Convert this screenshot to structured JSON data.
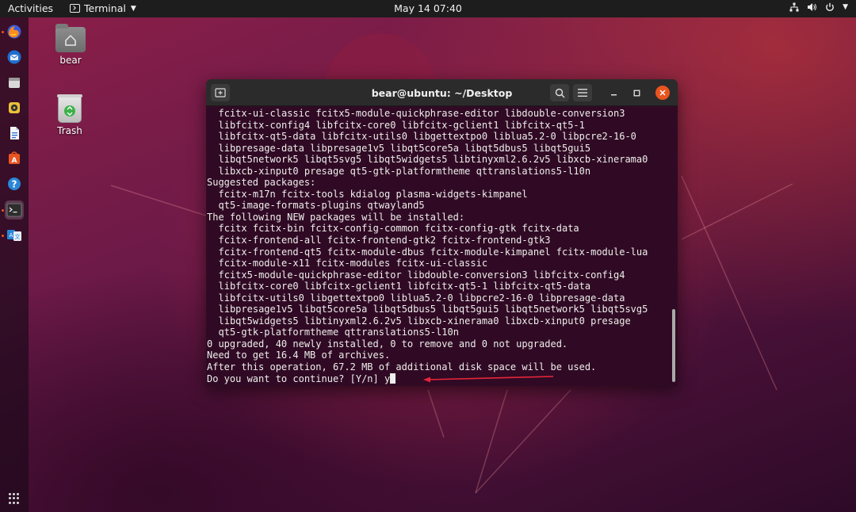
{
  "topbar": {
    "activities": "Activities",
    "app_name": "Terminal",
    "clock": "May 14  07:40"
  },
  "desktop": {
    "home_label": "bear",
    "trash_label": "Trash"
  },
  "dock": {
    "items": [
      "firefox-icon",
      "thunderbird-icon",
      "files-icon",
      "rhythmbox-icon",
      "libreoffice-writer-icon",
      "software-center-icon",
      "help-icon",
      "terminal-icon",
      "language-support-icon"
    ],
    "active": "terminal-icon"
  },
  "terminal": {
    "title": "bear@ubuntu: ~/Desktop",
    "lines": [
      {
        "text": "fcitx-ui-classic fcitx5-module-quickphrase-editor libdouble-conversion3",
        "indent": true
      },
      {
        "text": "libfcitx-config4 libfcitx-core0 libfcitx-gclient1 libfcitx-qt5-1",
        "indent": true
      },
      {
        "text": "libfcitx-qt5-data libfcitx-utils0 libgettextpo0 liblua5.2-0 libpcre2-16-0",
        "indent": true
      },
      {
        "text": "libpresage-data libpresage1v5 libqt5core5a libqt5dbus5 libqt5gui5",
        "indent": true
      },
      {
        "text": "libqt5network5 libqt5svg5 libqt5widgets5 libtinyxml2.6.2v5 libxcb-xinerama0",
        "indent": true
      },
      {
        "text": "libxcb-xinput0 presage qt5-gtk-platformtheme qttranslations5-l10n",
        "indent": true
      },
      {
        "text": "Suggested packages:",
        "indent": false
      },
      {
        "text": "fcitx-m17n fcitx-tools kdialog plasma-widgets-kimpanel",
        "indent": true
      },
      {
        "text": "qt5-image-formats-plugins qtwayland5",
        "indent": true
      },
      {
        "text": "The following NEW packages will be installed:",
        "indent": false
      },
      {
        "text": "fcitx fcitx-bin fcitx-config-common fcitx-config-gtk fcitx-data",
        "indent": true
      },
      {
        "text": "fcitx-frontend-all fcitx-frontend-gtk2 fcitx-frontend-gtk3",
        "indent": true
      },
      {
        "text": "fcitx-frontend-qt5 fcitx-module-dbus fcitx-module-kimpanel fcitx-module-lua",
        "indent": true
      },
      {
        "text": "fcitx-module-x11 fcitx-modules fcitx-ui-classic",
        "indent": true
      },
      {
        "text": "fcitx5-module-quickphrase-editor libdouble-conversion3 libfcitx-config4",
        "indent": true
      },
      {
        "text": "libfcitx-core0 libfcitx-gclient1 libfcitx-qt5-1 libfcitx-qt5-data",
        "indent": true
      },
      {
        "text": "libfcitx-utils0 libgettextpo0 liblua5.2-0 libpcre2-16-0 libpresage-data",
        "indent": true
      },
      {
        "text": "libpresage1v5 libqt5core5a libqt5dbus5 libqt5gui5 libqt5network5 libqt5svg5",
        "indent": true
      },
      {
        "text": "libqt5widgets5 libtinyxml2.6.2v5 libxcb-xinerama0 libxcb-xinput0 presage",
        "indent": true
      },
      {
        "text": "qt5-gtk-platformtheme qttranslations5-l10n",
        "indent": true
      },
      {
        "text": "0 upgraded, 40 newly installed, 0 to remove and 0 not upgraded.",
        "indent": false
      },
      {
        "text": "Need to get 16.4 MB of archives.",
        "indent": false
      },
      {
        "text": "After this operation, 67.2 MB of additional disk space will be used.",
        "indent": false
      }
    ],
    "prompt": "Do you want to continue? [Y/n] ",
    "input": "y"
  },
  "colors": {
    "terminal_bg": "#300a24",
    "accent": "#e95420",
    "annotation_arrow": "#e8263a"
  }
}
